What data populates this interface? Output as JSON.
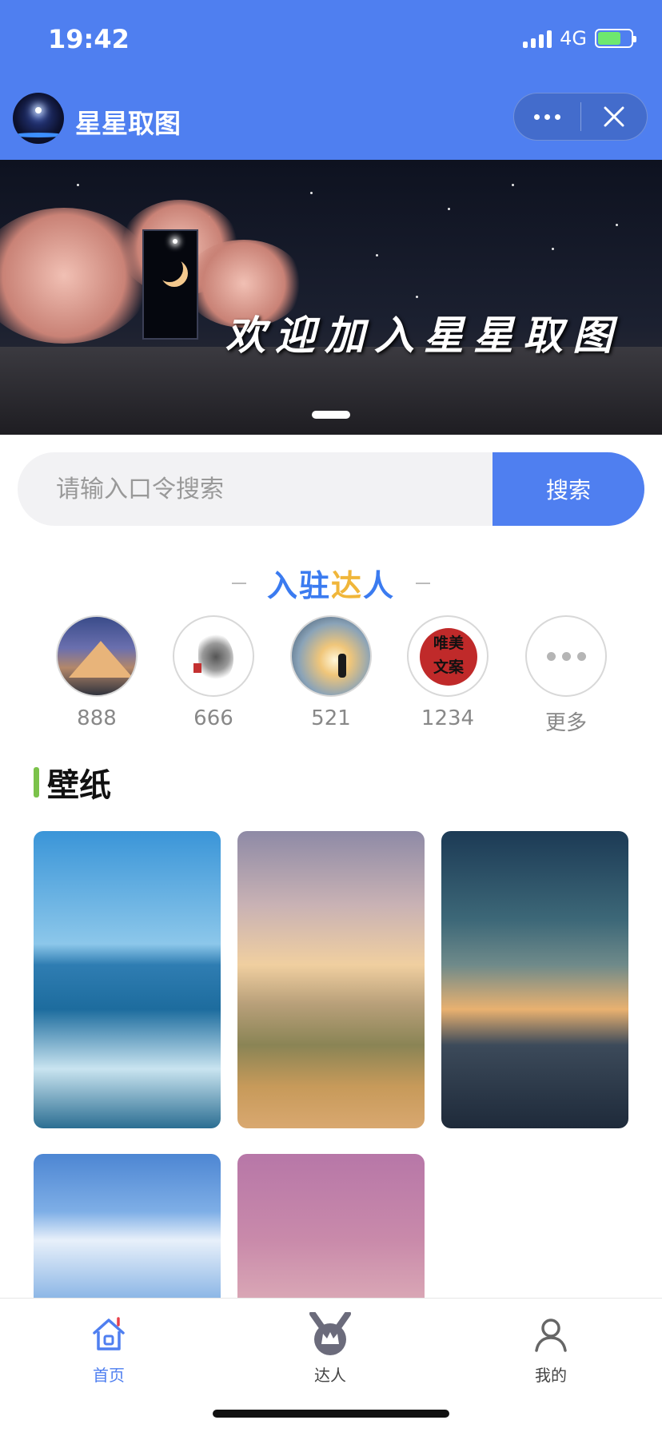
{
  "status_bar": {
    "time": "19:42",
    "network": "4G",
    "battery_icon": "battery-charging-icon"
  },
  "nav": {
    "title": "星星取图",
    "more_icon": "more-dots-icon",
    "close_icon": "close-icon"
  },
  "banner": {
    "text": "欢迎加入星星取图",
    "slide_index": 1,
    "slide_count": 1
  },
  "search": {
    "placeholder": "请输入口令搜索",
    "value": "",
    "button_label": "搜索"
  },
  "experts": {
    "title_part1": "入驻",
    "title_highlight": "达",
    "title_part2": "人",
    "items": [
      {
        "label": "888",
        "avatar": "mountain-avatar"
      },
      {
        "label": "666",
        "avatar": "ink-painting-avatar"
      },
      {
        "label": "521",
        "avatar": "desert-avatar"
      },
      {
        "label": "1234",
        "avatar": "wenan-seal-avatar",
        "avatar_text": [
          "唯美",
          "文案"
        ]
      },
      {
        "label": "更多",
        "avatar": "more-icon"
      }
    ]
  },
  "wallpaper": {
    "title": "壁纸",
    "accent": "#7bc24a",
    "tiles": [
      "ocean-wake",
      "tuscany-hills",
      "sunset-sea",
      "cloudy-sky",
      "pink-sky"
    ]
  },
  "tab_bar": {
    "items": [
      {
        "label": "首页",
        "icon": "home-icon",
        "active": true
      },
      {
        "label": "达人",
        "icon": "crown-medal-icon",
        "active": false
      },
      {
        "label": "我的",
        "icon": "user-icon",
        "active": false
      }
    ]
  },
  "colors": {
    "primary": "#4f7ff0",
    "highlight": "#f0b63a"
  }
}
